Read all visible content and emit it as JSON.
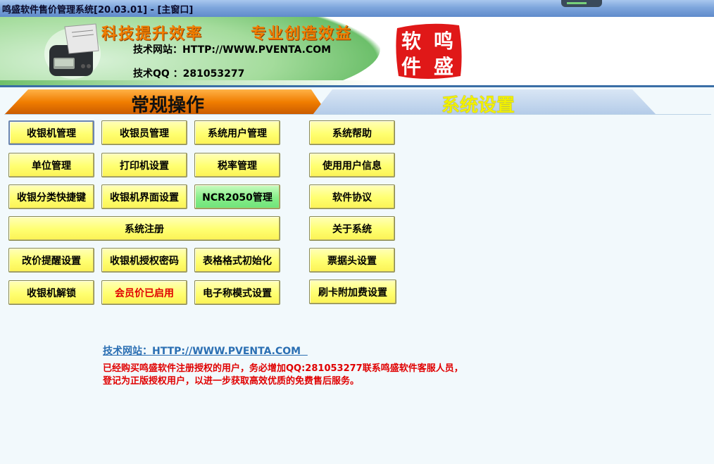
{
  "window": {
    "title": "鸣盛软件售价管理系统[20.03.01] - [主窗口]"
  },
  "banner": {
    "slogan_left": "科技提升效率",
    "slogan_right": "专业创造效益",
    "website": "技术网站：HTTP://WWW.PVENTA.COM",
    "qq": "技术QQ ：281053277",
    "seal_chars": [
      "软",
      "鸣",
      "件",
      "盛"
    ]
  },
  "tabs": {
    "general": "常规操作",
    "system": "系统设置"
  },
  "buttons": {
    "cashier_machine": "收银机管理",
    "cashier_staff": "收银员管理",
    "system_users": "系统用户管理",
    "unit": "单位管理",
    "printer": "打印机设置",
    "tax": "税率管理",
    "category_shortcut": "收银分类快捷键",
    "cashier_ui": "收银机界面设置",
    "ncr2050": "NCR2050管理",
    "register": "系统注册",
    "price_alert": "改价提醒设置",
    "auth_password": "收银机授权密码",
    "table_init": "表格格式初始化",
    "unlock": "收银机解锁",
    "member_price": "会员价已启用",
    "scale_mode": "电子称模式设置",
    "help": "系统帮助",
    "user_info": "使用用户信息",
    "agreement": "软件协议",
    "about": "关于系统",
    "receipt_header": "票据头设置",
    "card_surcharge": "刷卡附加费设置"
  },
  "footer": {
    "link": "技术网站：HTTP://WWW.PVENTA.COM  ",
    "notice_line1": "已经购买鸣盛软件注册授权的用户，务必增加QQ:281053277联系鸣盛软件客服人员，",
    "notice_line2": "登记为正版授权用户，以进一步获取高效优质的免费售后服务。"
  },
  "colors": {
    "accent_orange": "#f07d00",
    "button_yellow": "#ffff70",
    "button_green": "#86ee88",
    "notice_red": "#e00000",
    "link_blue": "#2b6fb3"
  }
}
